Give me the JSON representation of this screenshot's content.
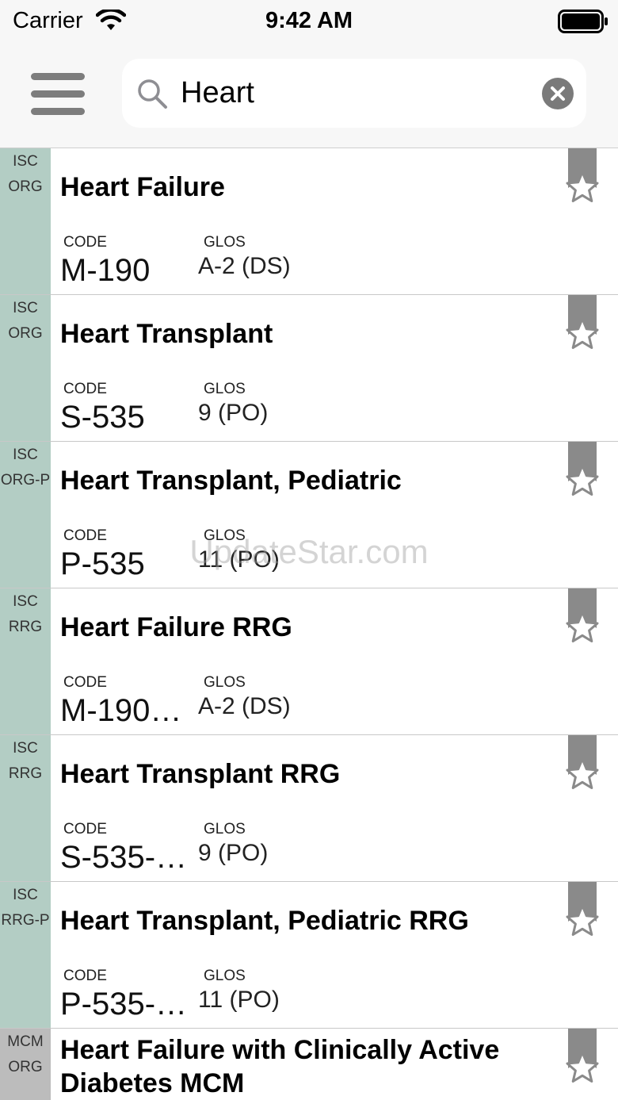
{
  "status_bar": {
    "carrier": "Carrier",
    "time": "9:42 AM"
  },
  "navbar": {
    "menu_icon": "hamburger-menu-icon"
  },
  "search": {
    "value": "Heart",
    "search_icon": "magnifier-icon",
    "clear_icon": "clear-x-icon"
  },
  "results": [
    {
      "tag_top": "ISC",
      "tag_bottom": "ORG",
      "title": "Heart Failure",
      "code_label": "CODE",
      "code": "M-190",
      "glos_label": "GLOS",
      "glos": "A-2 (DS)"
    },
    {
      "tag_top": "ISC",
      "tag_bottom": "ORG",
      "title": "Heart Transplant",
      "code_label": "CODE",
      "code": "S-535",
      "glos_label": "GLOS",
      "glos": "9 (PO)"
    },
    {
      "tag_top": "ISC",
      "tag_bottom": "ORG-P",
      "title": "Heart Transplant, Pediatric",
      "code_label": "CODE",
      "code": "P-535",
      "glos_label": "GLOS",
      "glos": "11 (PO)"
    },
    {
      "tag_top": "ISC",
      "tag_bottom": "RRG",
      "title": "Heart Failure RRG",
      "code_label": "CODE",
      "code": "M-190…",
      "glos_label": "GLOS",
      "glos": "A-2 (DS)"
    },
    {
      "tag_top": "ISC",
      "tag_bottom": "RRG",
      "title": "Heart Transplant RRG",
      "code_label": "CODE",
      "code": "S-535-…",
      "glos_label": "GLOS",
      "glos": "9 (PO)"
    },
    {
      "tag_top": "ISC",
      "tag_bottom": "RRG-P",
      "title": "Heart Transplant, Pediatric RRG",
      "code_label": "CODE",
      "code": "P-535-…",
      "glos_label": "GLOS",
      "glos": "11 (PO)"
    },
    {
      "tag_top": "MCM",
      "tag_bottom": "ORG",
      "title": "Heart Failure with Clinically Active Diabetes MCM"
    }
  ],
  "colors": {
    "tag_isc": "#b3cdc4",
    "tag_mcm": "#bcbcbc",
    "bookmark": "#8a8a8a"
  },
  "watermark": "UpdateStar.com"
}
